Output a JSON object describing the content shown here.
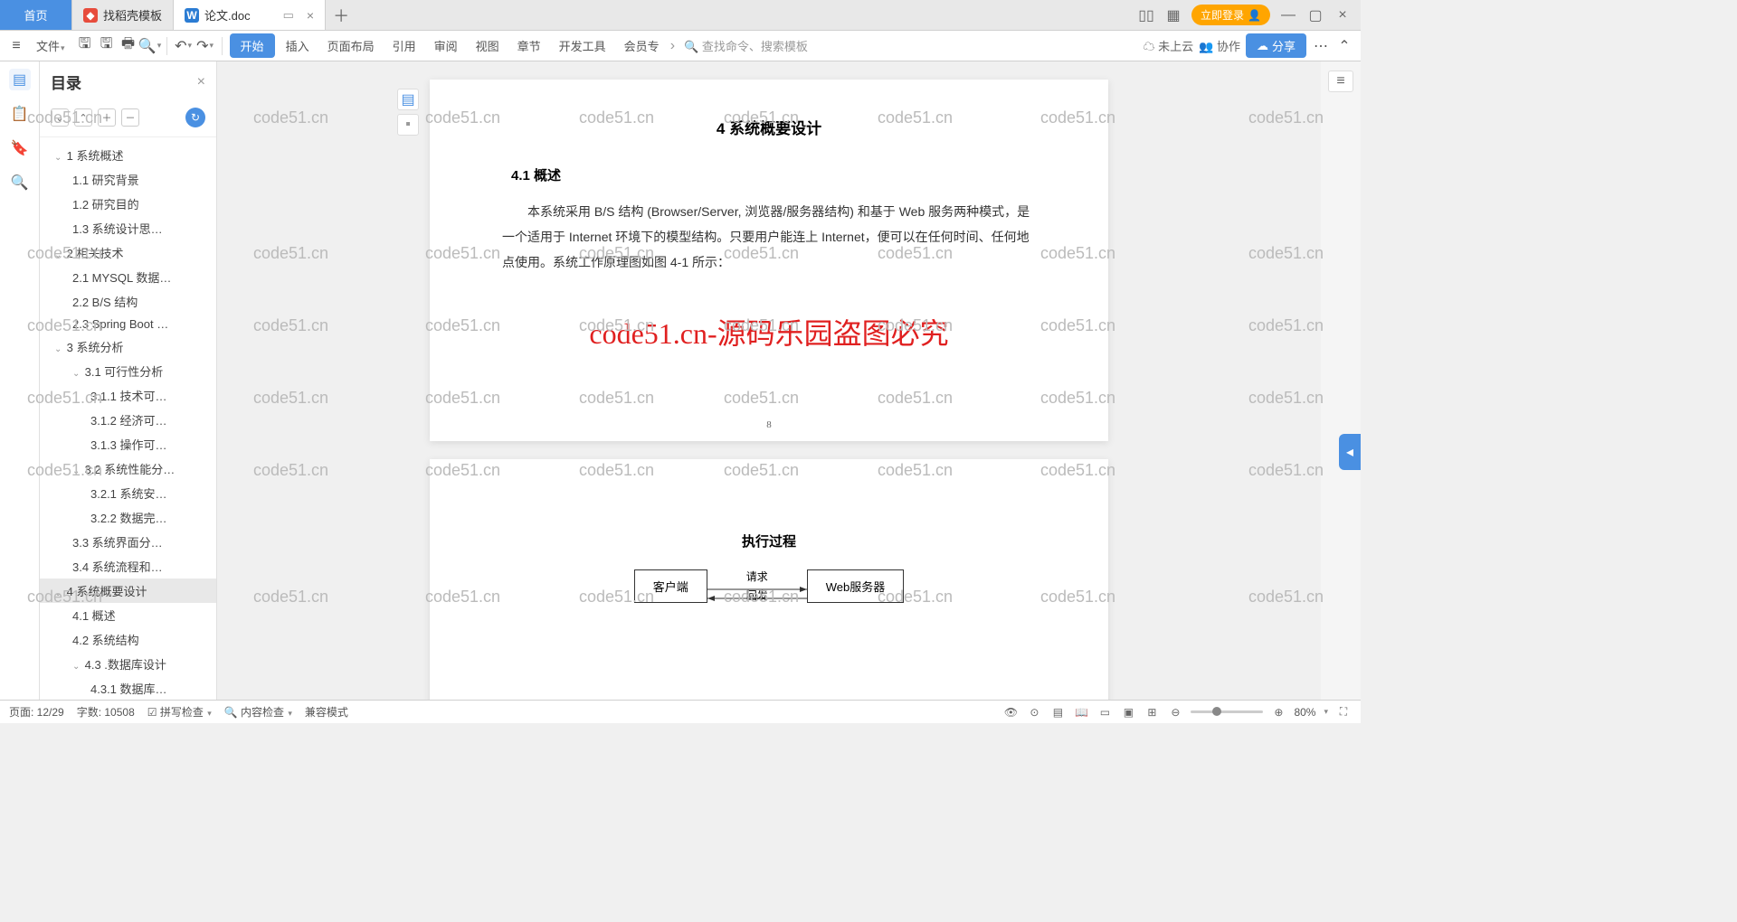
{
  "tabs": {
    "home": "首页",
    "t1": "找稻壳模板",
    "t2": "论文.doc"
  },
  "login": "立即登录",
  "ribbon": {
    "file": "文件",
    "items": [
      "开始",
      "插入",
      "页面布局",
      "引用",
      "审阅",
      "视图",
      "章节",
      "开发工具",
      "会员专"
    ],
    "search_ph": "查找命令、搜索模板",
    "cloud": "未上云",
    "collab": "协作",
    "share": "分享"
  },
  "outline": {
    "title": "目录",
    "tree": [
      {
        "lv": 1,
        "c": 1,
        "t": "1 系统概述"
      },
      {
        "lv": 2,
        "c": 0,
        "t": "1.1 研究背景"
      },
      {
        "lv": 2,
        "c": 0,
        "t": "1.2 研究目的"
      },
      {
        "lv": 2,
        "c": 0,
        "t": "1.3 系统设计思…"
      },
      {
        "lv": 1,
        "c": 1,
        "t": "2 相关技术"
      },
      {
        "lv": 2,
        "c": 0,
        "t": "2.1 MYSQL 数据…"
      },
      {
        "lv": 2,
        "c": 0,
        "t": "2.2 B/S 结构"
      },
      {
        "lv": 2,
        "c": 0,
        "t": "2.3 Spring Boot …"
      },
      {
        "lv": 1,
        "c": 1,
        "t": "3 系统分析"
      },
      {
        "lv": 2,
        "c": 1,
        "t": "3.1 可行性分析"
      },
      {
        "lv": 3,
        "c": 0,
        "t": "3.1.1 技术可…"
      },
      {
        "lv": 3,
        "c": 0,
        "t": "3.1.2 经济可…"
      },
      {
        "lv": 3,
        "c": 0,
        "t": "3.1.3 操作可…"
      },
      {
        "lv": 2,
        "c": 1,
        "t": "3.2 系统性能分…"
      },
      {
        "lv": 3,
        "c": 0,
        "t": "3.2.1  系统安…"
      },
      {
        "lv": 3,
        "c": 0,
        "t": "3.2.2 数据完…"
      },
      {
        "lv": 2,
        "c": 0,
        "t": "3.3 系统界面分…"
      },
      {
        "lv": 2,
        "c": 0,
        "t": "3.4 系统流程和…"
      },
      {
        "lv": 1,
        "c": 1,
        "t": "4 系统概要设计",
        "sel": true
      },
      {
        "lv": 2,
        "c": 0,
        "t": "4.1 概述"
      },
      {
        "lv": 2,
        "c": 0,
        "t": "4.2 系统结构"
      },
      {
        "lv": 2,
        "c": 1,
        "t": "4.3 .数据库设计"
      },
      {
        "lv": 3,
        "c": 0,
        "t": "4.3.1 数据库…"
      }
    ]
  },
  "doc": {
    "h1": "4 系统概要设计",
    "h2": "4.1 概述",
    "para": "本系统采用 B/S 结构 (Browser/Server, 浏览器/服务器结构) 和基于 Web 服务两种模式，是一个适用于 Internet 环境下的模型结构。只要用户能连上 Internet，便可以在任何时间、任何地点使用。系统工作原理图如图 4-1 所示：",
    "watermark_big": "code51.cn-源码乐园盗图必究",
    "pgnum": "8",
    "diag_title": "执行过程",
    "diag_left": "客户端",
    "diag_right": "Web服务器",
    "diag_req": "请求",
    "diag_resp": "回发"
  },
  "status": {
    "page": "页面: 12/29",
    "words": "字数: 10508",
    "spell": "拼写检查",
    "content": "内容检查",
    "compat": "兼容模式",
    "zoom": "80%"
  },
  "wm": "code51.cn"
}
